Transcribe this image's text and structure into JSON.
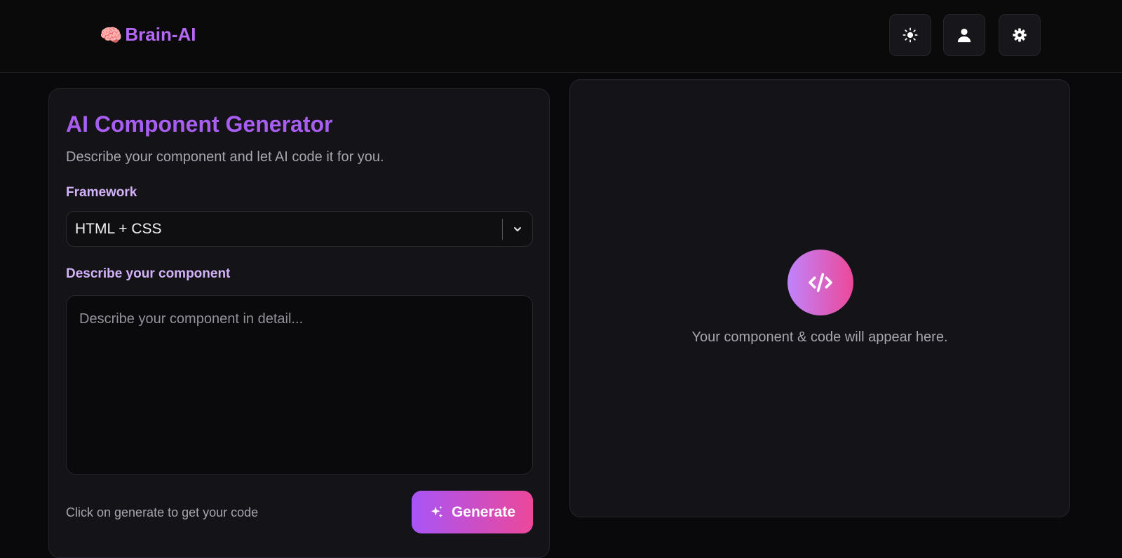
{
  "header": {
    "brand_emoji": "🧠",
    "brand_name": "Brain-AI",
    "buttons": [
      {
        "name": "theme-toggle-button",
        "icon": "sun-icon"
      },
      {
        "name": "profile-button",
        "icon": "user-icon"
      },
      {
        "name": "settings-button",
        "icon": "gear-icon"
      }
    ]
  },
  "generator": {
    "title": "AI Component Generator",
    "subtitle": "Describe your component and let AI code it for you.",
    "framework_label": "Framework",
    "framework_value": "HTML + CSS",
    "describe_label": "Describe your component",
    "describe_placeholder": "Describe your component in detail...",
    "hint": "Click on generate to get your code",
    "generate_label": "Generate"
  },
  "preview": {
    "icon": "code-icon",
    "placeholder": "Your component & code will appear here."
  },
  "colors": {
    "accent": "#a855f7",
    "accent_end": "#ec4899",
    "background": "#09090b",
    "card": "#131318"
  }
}
